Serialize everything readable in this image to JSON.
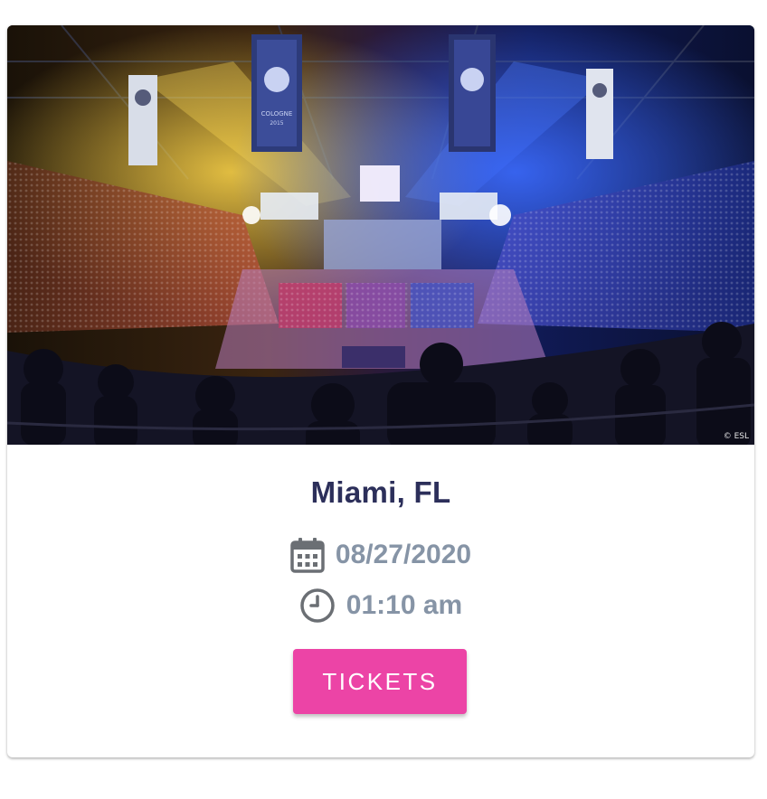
{
  "event": {
    "photo_alt": "Esports arena packed with spectators",
    "photo_credit": "© ESL",
    "banner_text": "COLOGNE",
    "banner_year": "2015",
    "city": "Miami, FL",
    "date": "08/27/2020",
    "time": "01:10 am",
    "tickets_label": "TICKETS"
  },
  "icons": {
    "date": "calendar-icon",
    "time": "clock-icon"
  },
  "colors": {
    "city_text": "#2c2f5a",
    "meta_text": "#8694a6",
    "tickets_button": "#ec44a6",
    "icon": "#6b6f74"
  }
}
